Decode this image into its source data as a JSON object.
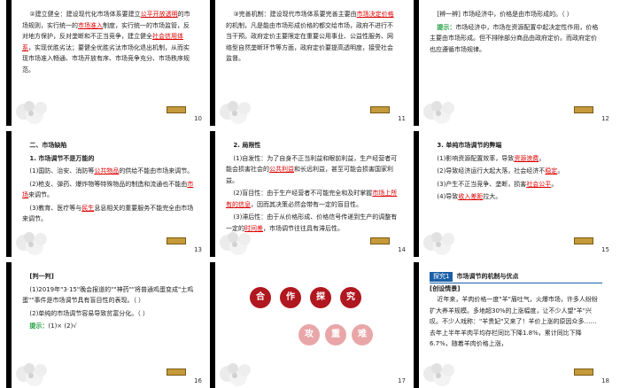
{
  "slides": [
    {
      "page": "10",
      "paras": [
        [
          "②建立健全：建设现代化市场体系要建立",
          {
            "u": "公平开放透明"
          },
          "的市场规则，实行统一的",
          {
            "u": "市场准入"
          },
          "制度，实行统一的市场监管，反对地方保护，反对垄断和不正当竞争，建立健全",
          {
            "u": "社会信用体系"
          },
          "，实现优胜劣汰；要健全优胜劣汰市场化退出机制，从而实现市场准入畅通、市场开放有序、市场竞争充分、市场秩序规范。"
        ]
      ]
    },
    {
      "page": "11",
      "paras": [
        [
          "③完善机制：建设现代市场体系要完善主要由",
          {
            "u": "市场决定价格"
          },
          "的机制，凡是能由市场形成价格的都交给市场，政府不进行不当干预。政府定价主要限定在重要公用事业、公益性服务、网络型自然垄断环节等方面，政府定价要提高透明度，接受社会监督。"
        ]
      ]
    },
    {
      "page": "12",
      "paras": [
        [
          "[辨一辨] 市场经济中，价格是由市场形成的。（ ）"
        ],
        [
          {
            "g": "提示："
          },
          "市场经济中，市场在资源配置中起决定性作用，价格主要由市场形成。但不排除部分商品由政府定价。而政府定价也应遵循市场规律。"
        ]
      ]
    },
    {
      "page": "13",
      "paras": [
        [
          {
            "b": "二、市场缺陷"
          }
        ],
        [
          {
            "b": "1. 市场调节不是万能的"
          }
        ],
        [
          "(1)国防、治安、消防等",
          {
            "u": "公共物品"
          },
          "的供给不能由市场来调节。"
        ],
        [
          "(2)枪支、弹药、爆炸物等特殊物品的制造和流通也不能由",
          {
            "u": "市场"
          },
          "来调节。"
        ],
        [
          "(3)教育、医疗等与",
          {
            "u": "民生"
          },
          "息息相关的重要服务不能完全由市场来调节。"
        ]
      ]
    },
    {
      "page": "14",
      "paras": [
        [
          {
            "b": "2. 局限性"
          }
        ],
        [
          "(1)自发性：为了自身不正当利益和眼前利益，生产经营者可能会损害社会的",
          {
            "u": "公共利益"
          },
          "和长远利益，甚至可能会损害国家利益。"
        ],
        [
          "(2)盲目性：由于生产经营者不可能完全和及时掌握",
          {
            "u": "市场上所有的信息"
          },
          "，因而其决策必然会带有一定的盲目性。"
        ],
        [
          "(3)滞后性：由于从价格形成、价格信号传递到生产的调整有一定的",
          {
            "u": "时间差"
          },
          "，市场调节往往具有滞后性。"
        ]
      ]
    },
    {
      "page": "15",
      "paras": [
        [
          {
            "b": "3. 单纯市场调节的弊端"
          }
        ],
        [
          "(1)影响资源配置效率，导致",
          {
            "u": "资源浪费"
          },
          "。"
        ],
        [
          "(2)导致经济运行大起大落，社会经济不",
          {
            "u": "稳定"
          },
          "。"
        ],
        [
          "(3)产生不正当竞争、垄断，损害",
          {
            "u": "社会公平"
          },
          "。"
        ],
        [
          "(4)导致",
          {
            "u": "收入差距"
          },
          "拉大。"
        ]
      ]
    },
    {
      "page": "16",
      "paras": [
        [
          {
            "b": "[判一判]"
          }
        ],
        [
          "(1)2019年\"3·15\"晚会报道的\"\"神药\"\"将普通鸡蛋变成\"土鸡蛋\"\"事件是市场调节具有盲目性的表现。（ ）"
        ],
        [
          "(2)单纯的市场调节容易导致贫富分化。（ ）"
        ],
        [
          {
            "g": "提示："
          },
          "(1)×  (2)√"
        ]
      ]
    },
    {
      "page": "17",
      "seals_top": [
        "合",
        "作",
        "探",
        "究"
      ],
      "seals_bottom": [
        "攻",
        "重",
        "难"
      ]
    },
    {
      "page": "18",
      "tag": "探究1",
      "heading": "市场调节的机制与优点",
      "subheading": "[创设情景]",
      "paras": [
        [
          "近年来，羊肉价格一度\"羊\"眉吐气，火爆市场，许多人纷纷扩大养羊规模。多地超30%的上涨幅度，让不少人望\"羊\"兴叹。不少人戏称：\"羊贵妃\"又来了！羊价上涨的原因众多……去年上半年羊肉平均存栏同比下降1.8%，累计同比下降6.7%，随着羊肉价格上涨，"
        ]
      ]
    }
  ]
}
